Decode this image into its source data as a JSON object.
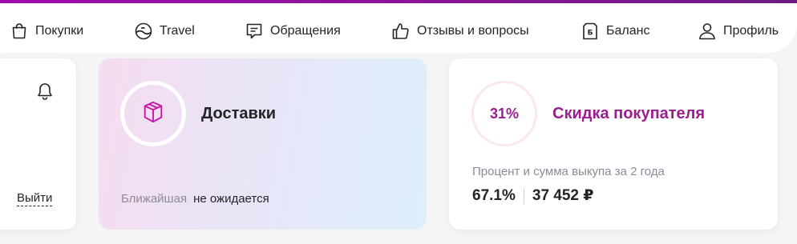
{
  "nav": {
    "items": [
      {
        "label": "Покупки",
        "icon": "shopping-bag-icon"
      },
      {
        "label": "Travel",
        "icon": "travel-globe-icon"
      },
      {
        "label": "Обращения",
        "icon": "message-icon"
      },
      {
        "label": "Отзывы и вопросы",
        "icon": "thumbs-up-icon"
      },
      {
        "label": "Баланс",
        "icon": "balance-ruble-icon"
      },
      {
        "label": "Профиль",
        "icon": "user-icon"
      }
    ]
  },
  "left_card": {
    "logout_label": "Выйти"
  },
  "delivery_card": {
    "title": "Доставки",
    "nearest_label": "Ближайшая",
    "nearest_value": "не ожидается"
  },
  "discount_card": {
    "percent": "31%",
    "title": "Скидка покупателя",
    "subtitle": "Процент и сумма выкупа за 2 года",
    "buyout_percent": "67.1%",
    "buyout_sum": "37 452 ₽"
  },
  "colors": {
    "brand": "#9b1d8f",
    "accent_gradient_start": "#a10cb0",
    "muted_text": "#8b8b9a"
  }
}
